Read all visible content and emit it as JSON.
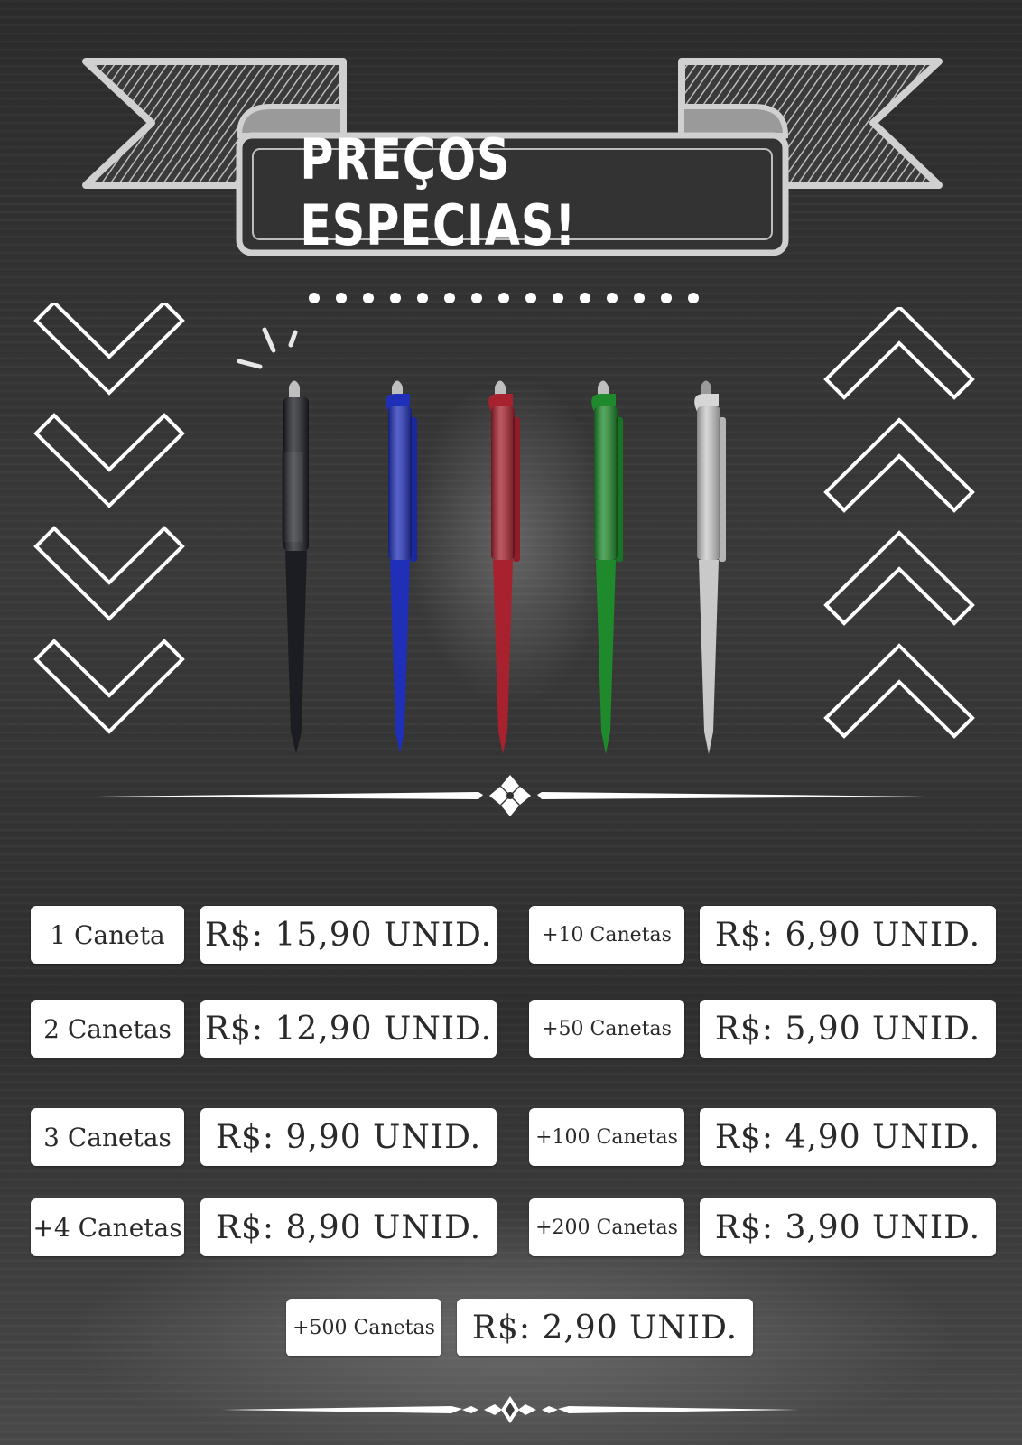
{
  "header": {
    "title": "PREÇOS ESPECIAS!"
  },
  "pens": [
    {
      "color": "black",
      "hex": "#1c1d22"
    },
    {
      "color": "blue",
      "hex": "#1f2fb8"
    },
    {
      "color": "red",
      "hex": "#a8212e"
    },
    {
      "color": "green",
      "hex": "#1e8a2c"
    },
    {
      "color": "silver",
      "hex": "#c9c9c9"
    }
  ],
  "price_table": [
    {
      "quantity": "1 Caneta",
      "price": "R$: 15,90 UNID."
    },
    {
      "quantity": "2 Canetas",
      "price": "R$: 12,90 UNID."
    },
    {
      "quantity": "3 Canetas",
      "price": "R$: 9,90 UNID."
    },
    {
      "quantity": "+4 Canetas",
      "price": "R$: 8,90 UNID."
    },
    {
      "quantity": "+10 Canetas",
      "price": "R$: 6,90 UNID."
    },
    {
      "quantity": "+50 Canetas",
      "price": "R$: 5,90 UNID."
    },
    {
      "quantity": "+100 Canetas",
      "price": "R$: 4,90 UNID."
    },
    {
      "quantity": "+200 Canetas",
      "price": "R$: 3,90 UNID."
    },
    {
      "quantity": "+500 Canetas",
      "price": "R$: 2,90 UNID."
    }
  ],
  "colors": {
    "background": "#2e2e2e",
    "ribbon": "#c8c8c8",
    "box": "#ffffff",
    "text": "#2a2a2a"
  }
}
